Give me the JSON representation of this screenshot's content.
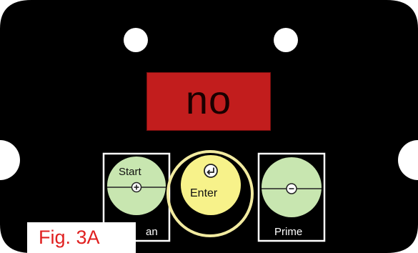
{
  "display": {
    "text": "no",
    "color": "#c21d1d"
  },
  "keys": {
    "start_label": "Start",
    "start_symbol": "plus-icon",
    "clean_label_visible": "an",
    "enter_label": "Enter",
    "enter_symbol": "return-arrow-icon",
    "prime_label": "Prime",
    "prime_symbol": "minus-icon"
  },
  "figure": {
    "label": "Fig. 3A"
  },
  "colors": {
    "panel": "#000000",
    "key_green": "#c8e6b0",
    "enter_yellow": "#f7f28a",
    "highlight_ring": "#f2eba0",
    "figure_label": "#e02020"
  }
}
